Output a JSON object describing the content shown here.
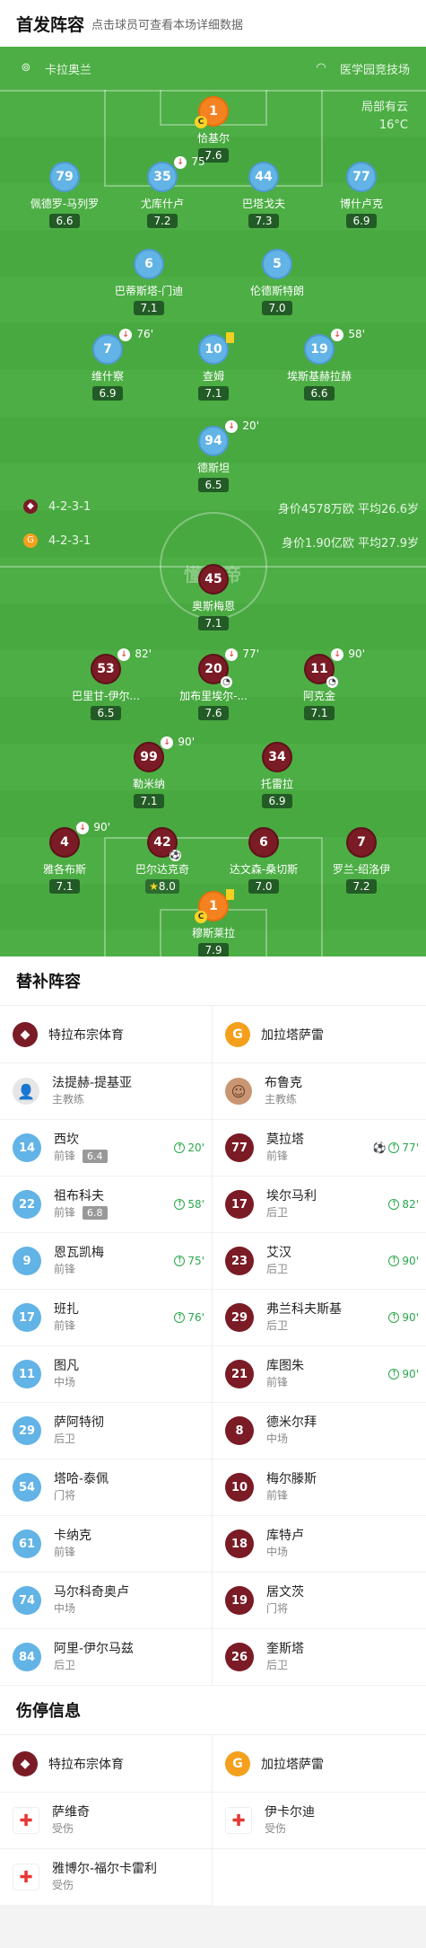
{
  "header": {
    "title": "首发阵容",
    "subtitle": "点击球员可查看本场详细数据"
  },
  "field": {
    "home_team": "卡拉奥兰",
    "venue": "医学园竞技场",
    "weather": "局部有云",
    "temp": "16°C",
    "watermark": "懂球帝",
    "home_formation": "4-2-3-1",
    "home_value": "身价4578万欧 平均26.6岁",
    "away_formation": "4-2-3-1",
    "away_value": "身价1.90亿欧 平均27.9岁"
  },
  "home_players": [
    {
      "num": "1",
      "name": "恰基尔",
      "rating": "7.6"
    },
    {
      "num": "79",
      "name": "佩德罗-马列罗",
      "rating": "6.6"
    },
    {
      "num": "35",
      "name": "尤库什卢",
      "rating": "7.2",
      "sub": "75'"
    },
    {
      "num": "44",
      "name": "巴塔戈夫",
      "rating": "7.3"
    },
    {
      "num": "77",
      "name": "博什卢克",
      "rating": "6.9"
    },
    {
      "num": "6",
      "name": "巴蒂斯塔-门迪",
      "rating": "7.1"
    },
    {
      "num": "5",
      "name": "伦德斯特朗",
      "rating": "7.0"
    },
    {
      "num": "7",
      "name": "维什察",
      "rating": "6.9",
      "sub": "76'"
    },
    {
      "num": "10",
      "name": "查姆",
      "rating": "7.1"
    },
    {
      "num": "19",
      "name": "埃斯基赫拉赫",
      "rating": "6.6",
      "sub": "58'"
    },
    {
      "num": "94",
      "name": "德斯坦",
      "rating": "6.5",
      "sub": "20'"
    }
  ],
  "away_players": [
    {
      "num": "45",
      "name": "奥斯梅恩",
      "rating": "7.1"
    },
    {
      "num": "53",
      "name": "巴里甘-伊尔...",
      "rating": "6.5",
      "sub": "82'"
    },
    {
      "num": "20",
      "name": "加布里埃尔-...",
      "rating": "7.6",
      "sub": "77'"
    },
    {
      "num": "11",
      "name": "阿克金",
      "rating": "7.1",
      "sub": "90'"
    },
    {
      "num": "99",
      "name": "勒米纳",
      "rating": "7.1",
      "sub": "90'"
    },
    {
      "num": "34",
      "name": "托雷拉",
      "rating": "6.9"
    },
    {
      "num": "4",
      "name": "雅各布斯",
      "rating": "7.1",
      "sub": "90'"
    },
    {
      "num": "42",
      "name": "巴尔达克奇",
      "rating": "8.0"
    },
    {
      "num": "6",
      "name": "达文森-桑切斯",
      "rating": "7.0"
    },
    {
      "num": "7",
      "name": "罗兰-绍洛伊",
      "rating": "7.2"
    },
    {
      "num": "1",
      "name": "穆斯莱拉",
      "rating": "7.9"
    }
  ],
  "subs": {
    "title": "替补阵容",
    "home_team": "特拉布宗体育",
    "away_team": "加拉塔萨雷",
    "home_coach": {
      "name": "法提赫-提基亚",
      "role": "主教练"
    },
    "away_coach": {
      "name": "布鲁克",
      "role": "主教练"
    },
    "home": [
      {
        "num": "14",
        "name": "西坎",
        "pos": "前锋",
        "rating": "6.4",
        "in": "20'"
      },
      {
        "num": "22",
        "name": "祖布科夫",
        "pos": "前锋",
        "rating": "6.8",
        "in": "58'"
      },
      {
        "num": "9",
        "name": "恩瓦凯梅",
        "pos": "前锋",
        "in": "75'"
      },
      {
        "num": "17",
        "name": "班扎",
        "pos": "前锋",
        "in": "76'"
      },
      {
        "num": "11",
        "name": "图凡",
        "pos": "中场"
      },
      {
        "num": "29",
        "name": "萨阿特彻",
        "pos": "后卫"
      },
      {
        "num": "54",
        "name": "塔哈-泰佩",
        "pos": "门将"
      },
      {
        "num": "61",
        "name": "卡纳克",
        "pos": "前锋"
      },
      {
        "num": "74",
        "name": "马尔科奇奥卢",
        "pos": "中场"
      },
      {
        "num": "84",
        "name": "阿里-伊尔马兹",
        "pos": "后卫"
      }
    ],
    "away": [
      {
        "num": "77",
        "name": "莫拉塔",
        "pos": "前锋",
        "in": "77'"
      },
      {
        "num": "17",
        "name": "埃尔马利",
        "pos": "后卫",
        "in": "82'"
      },
      {
        "num": "23",
        "name": "艾汉",
        "pos": "后卫",
        "in": "90'"
      },
      {
        "num": "29",
        "name": "弗兰科夫斯基",
        "pos": "后卫",
        "in": "90'"
      },
      {
        "num": "21",
        "name": "库图朱",
        "pos": "前锋",
        "in": "90'"
      },
      {
        "num": "8",
        "name": "德米尔拜",
        "pos": "中场"
      },
      {
        "num": "10",
        "name": "梅尔滕斯",
        "pos": "前锋"
      },
      {
        "num": "18",
        "name": "库特卢",
        "pos": "中场"
      },
      {
        "num": "19",
        "name": "居文茨",
        "pos": "门将"
      },
      {
        "num": "26",
        "name": "奎斯塔",
        "pos": "后卫"
      }
    ]
  },
  "injuries": {
    "title": "伤停信息",
    "home_team": "特拉布宗体育",
    "away_team": "加拉塔萨雷",
    "home": [
      {
        "name": "萨维奇",
        "status": "受伤"
      },
      {
        "name": "雅博尔-福尔卡雷利",
        "status": "受伤"
      }
    ],
    "away": [
      {
        "name": "伊卡尔迪",
        "status": "受伤"
      }
    ]
  },
  "colors": {
    "pitch": "#4cae44",
    "home": "#62b3e6",
    "away": "#7a1b25",
    "gk": "#f58220",
    "sub_in": "#29a84b"
  },
  "icons": {
    "stadium": "stadium-icon",
    "sub": "substitution-icon",
    "captain": "captain-badge-icon",
    "injury": "first-aid-icon"
  }
}
